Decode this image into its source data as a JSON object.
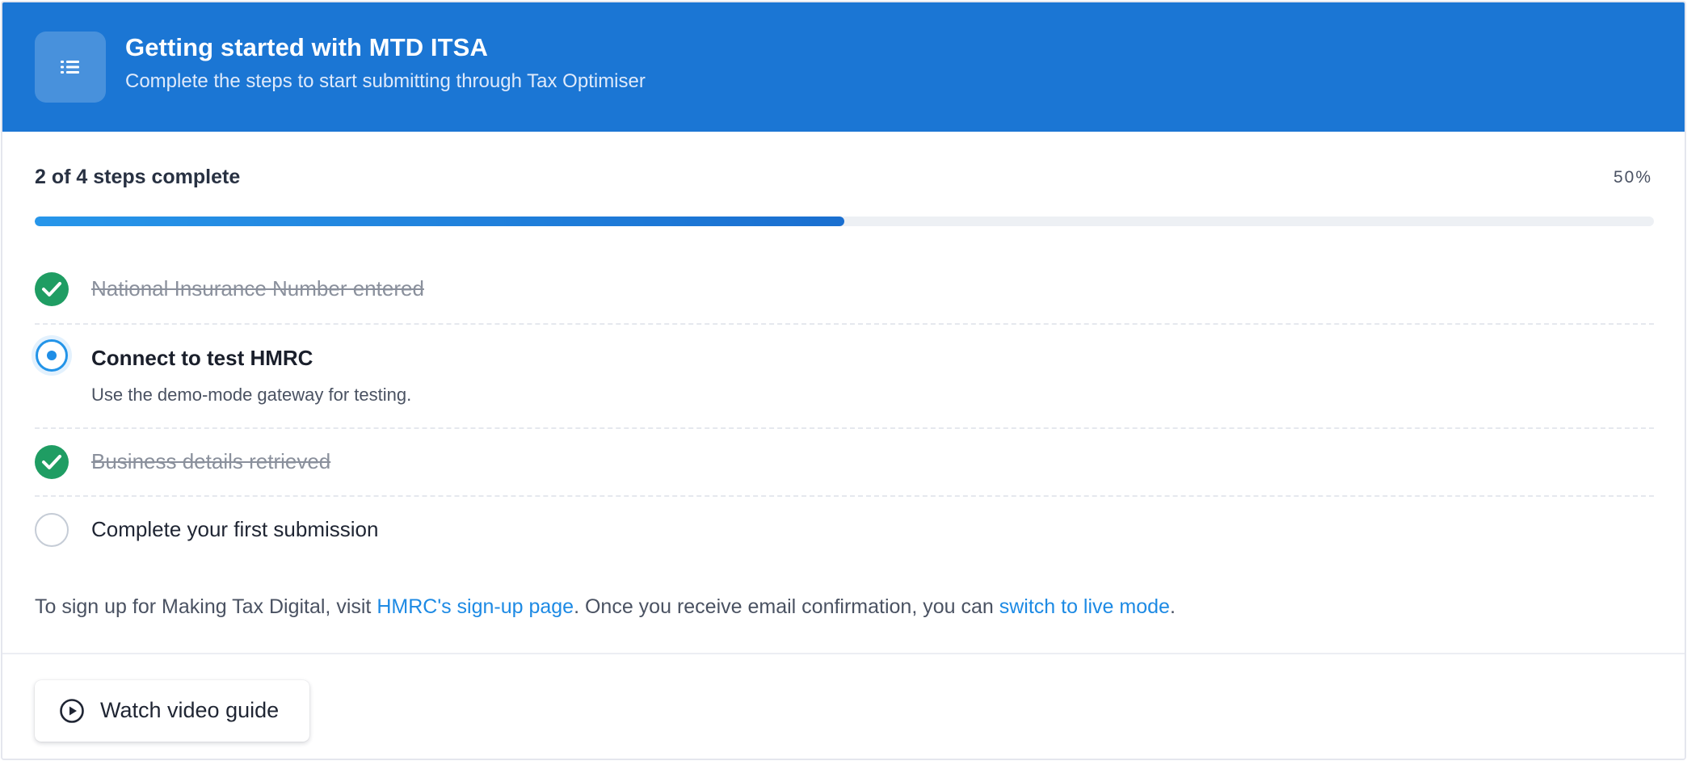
{
  "header": {
    "icon": "list-icon",
    "title": "Getting started with MTD ITSA",
    "subtitle": "Complete the steps to start submitting through Tax Optimiser"
  },
  "progress": {
    "label": "2 of 4 steps complete",
    "percent_text": "50%",
    "fill_fraction": 0.5
  },
  "steps": [
    {
      "label": "National Insurance Number entered",
      "status": "complete",
      "icon": "check-circle-icon"
    },
    {
      "label": "Connect to test HMRC",
      "description": "Use the demo-mode gateway for testing.",
      "status": "current",
      "icon": "radio-active-icon"
    },
    {
      "label": "Business details retrieved",
      "status": "complete",
      "icon": "check-circle-icon"
    },
    {
      "label": "Complete your first submission",
      "status": "pending",
      "icon": "empty-circle-icon"
    }
  ],
  "info": {
    "prefix": "To sign up for Making Tax Digital, visit ",
    "link1": "HMRC's sign-up page",
    "middle": ". Once you receive email confirmation, you can ",
    "link2": "switch to live mode",
    "suffix": "."
  },
  "footer": {
    "video_button_label": "Watch video guide",
    "video_icon": "play-circle-icon"
  },
  "colors": {
    "header_bg": "#1b76d4",
    "complete_green": "#1f9d63",
    "active_blue": "#2394e8",
    "link_blue": "#1d8ae4"
  }
}
